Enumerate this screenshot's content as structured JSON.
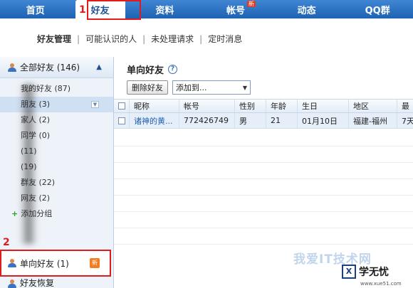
{
  "nav": {
    "items": [
      {
        "label": "首页"
      },
      {
        "label": "好友"
      },
      {
        "label": "资料"
      },
      {
        "label": "帐号",
        "badge": "新"
      },
      {
        "label": "动态"
      },
      {
        "label": "QQ群"
      }
    ],
    "active_index": 1,
    "step_marker": "1"
  },
  "subnav": {
    "items": [
      "好友管理",
      "可能认识的人",
      "未处理请求",
      "定时消息"
    ],
    "current": "好友管理"
  },
  "sidebar": {
    "all_friends": "全部好友 (146)",
    "groups": [
      "我的好友 (87)",
      "朋友 (3)",
      "家人 (2)",
      "同学 (0)",
      "(11)",
      "(19)",
      "群友 (22)",
      "网友 (2)"
    ],
    "add_group": "添加分组",
    "step_marker": "2",
    "oneway": "单向好友 (1)",
    "oneway_badge": "新",
    "recover": "好友恢复"
  },
  "main": {
    "title": "单向好友",
    "help_icon": "help-icon",
    "delete_button": "删除好友",
    "add_to_select": "添加到...",
    "table": {
      "headers": [
        "昵称",
        "帐号",
        "性别",
        "年龄",
        "生日",
        "地区",
        "最"
      ],
      "rows": [
        {
          "nickname": "诸神的黄...",
          "account": "772426749",
          "sex": "男",
          "age": "21",
          "birthday": "01月10日",
          "area": "福建-福州",
          "last": "7天"
        }
      ]
    }
  },
  "watermark": {
    "text": "我爱IT技术网",
    "logo_box": "X",
    "logo_name": "学无忧",
    "url": "www.xue51.com"
  },
  "colors": {
    "nav_blue": "#2f74c6",
    "highlight_red": "#e01b1b",
    "sidebar_bg": "#eef3f9"
  }
}
